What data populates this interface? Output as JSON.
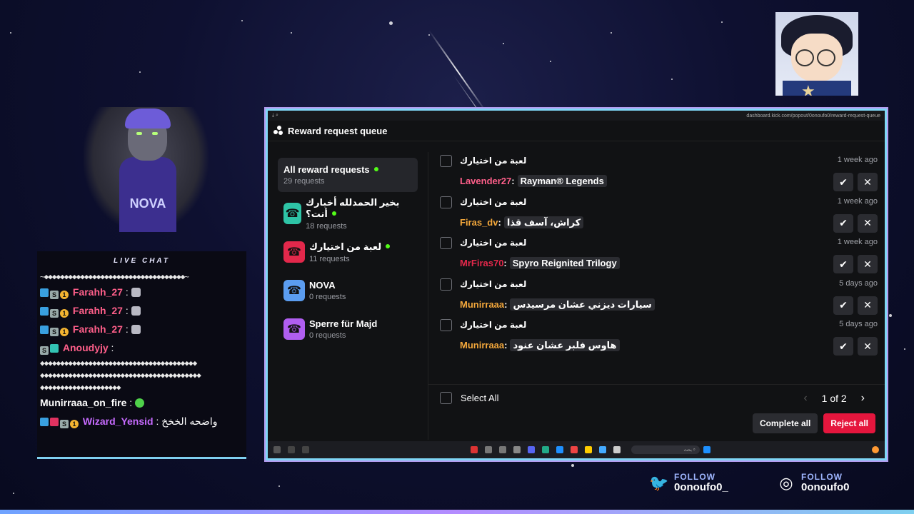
{
  "window": {
    "url": "dashboard.kick.com/popout/0onoufo0/reward-request-queue",
    "title": "Reward request queue"
  },
  "sidebar": {
    "items": [
      {
        "title": "All reward requests",
        "sub": "29 requests",
        "active": true,
        "dot": true,
        "color": "#2b2c31"
      },
      {
        "title": "بخير الحمدلله أخبارك أنت؟",
        "sub": "18 requests",
        "dot": true,
        "color": "#2ec4a6"
      },
      {
        "title": "لعبة من اختيارك",
        "sub": "11 requests",
        "dot": true,
        "color": "#e3284b"
      },
      {
        "title": "NOVA",
        "sub": "0 requests",
        "dot": false,
        "color": "#5b9df0"
      },
      {
        "title": "Sperre für Majd",
        "sub": "0 requests",
        "dot": false,
        "color": "#b05ef0"
      }
    ]
  },
  "requests": [
    {
      "title": "لعبة من اختيارك",
      "user": "Lavender27",
      "user_color": "#ff5f8a",
      "message": "Rayman® Legends",
      "time": "1 week ago"
    },
    {
      "title": "لعبة من اختيارك",
      "user": "Firas_dv",
      "user_color": "#f3a73b",
      "message": "كراش، آسف قذا",
      "time": "1 week ago"
    },
    {
      "title": "لعبة من اختيارك",
      "user": "MrFiras70",
      "user_color": "#e3284b",
      "message": "Spyro Reignited Trilogy",
      "time": "1 week ago"
    },
    {
      "title": "لعبة من اختيارك",
      "user": "Munirraaa",
      "user_color": "#f3a73b",
      "message": "سيارات ديزني عشان مرسيدس",
      "time": "5 days ago"
    },
    {
      "title": "لعبة من اختيارك",
      "user": "Munirraaa",
      "user_color": "#f3a73b",
      "message": "هاوس فلبر عشان عنود",
      "time": "5 days ago"
    }
  ],
  "footer": {
    "select_all": "Select All",
    "pager": "1 of 2",
    "complete_all": "Complete all",
    "reject_all": "Reject all"
  },
  "chat": {
    "title": "LIVE CHAT",
    "lines": [
      {
        "user": "Farahh_27",
        "color": "#ff5f8a"
      },
      {
        "user": "Farahh_27",
        "color": "#ff5f8a"
      },
      {
        "user": "Farahh_27",
        "color": "#ff5f8a"
      },
      {
        "user": "Anoudyjy",
        "color": "#ff5f8a"
      },
      {
        "user": "Munirraaa_on_fire",
        "color": "#ffffff"
      },
      {
        "user": "Wizard_Yensid",
        "color": "#c76bff",
        "message": "واضحه الخخخ"
      }
    ]
  },
  "avatar": {
    "shirt_text": "NOVA"
  },
  "social": {
    "follow_label": "FOLLOW",
    "twitter_handle": "0onoufo0_",
    "instagram_handle": "0onoufo0"
  },
  "taskbar": {
    "search_placeholder": "بحث"
  }
}
